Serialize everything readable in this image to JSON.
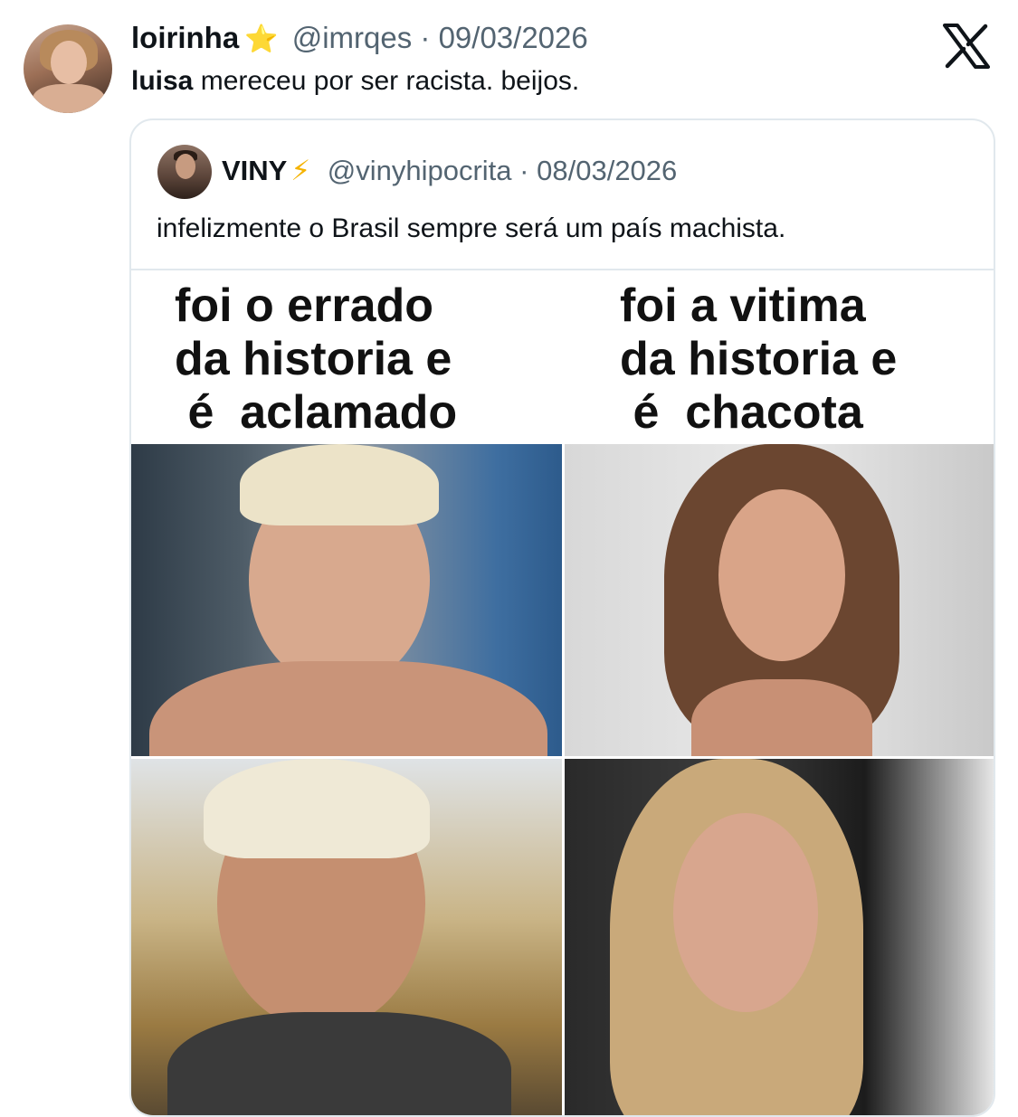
{
  "tweet": {
    "display_name": "loirinha",
    "badge": "⭐",
    "handle": "@imrqes",
    "separator": "·",
    "date": "09/03/2026",
    "text_bold": "luisa",
    "text_rest": " mereceu por ser racista. beijos."
  },
  "platform_logo": "x-logo",
  "quoted": {
    "display_name": "VINY",
    "badge": "⚡",
    "handle": "@vinyhipocrita",
    "separator": "·",
    "date": "08/03/2026",
    "text": "infelizmente o Brasil sempre será um país machista."
  },
  "meme": {
    "left_caption": "foi o errado\nda historia e\n é  aclamado",
    "right_caption": "foi a vitima\nda historia e\n é  chacota"
  }
}
